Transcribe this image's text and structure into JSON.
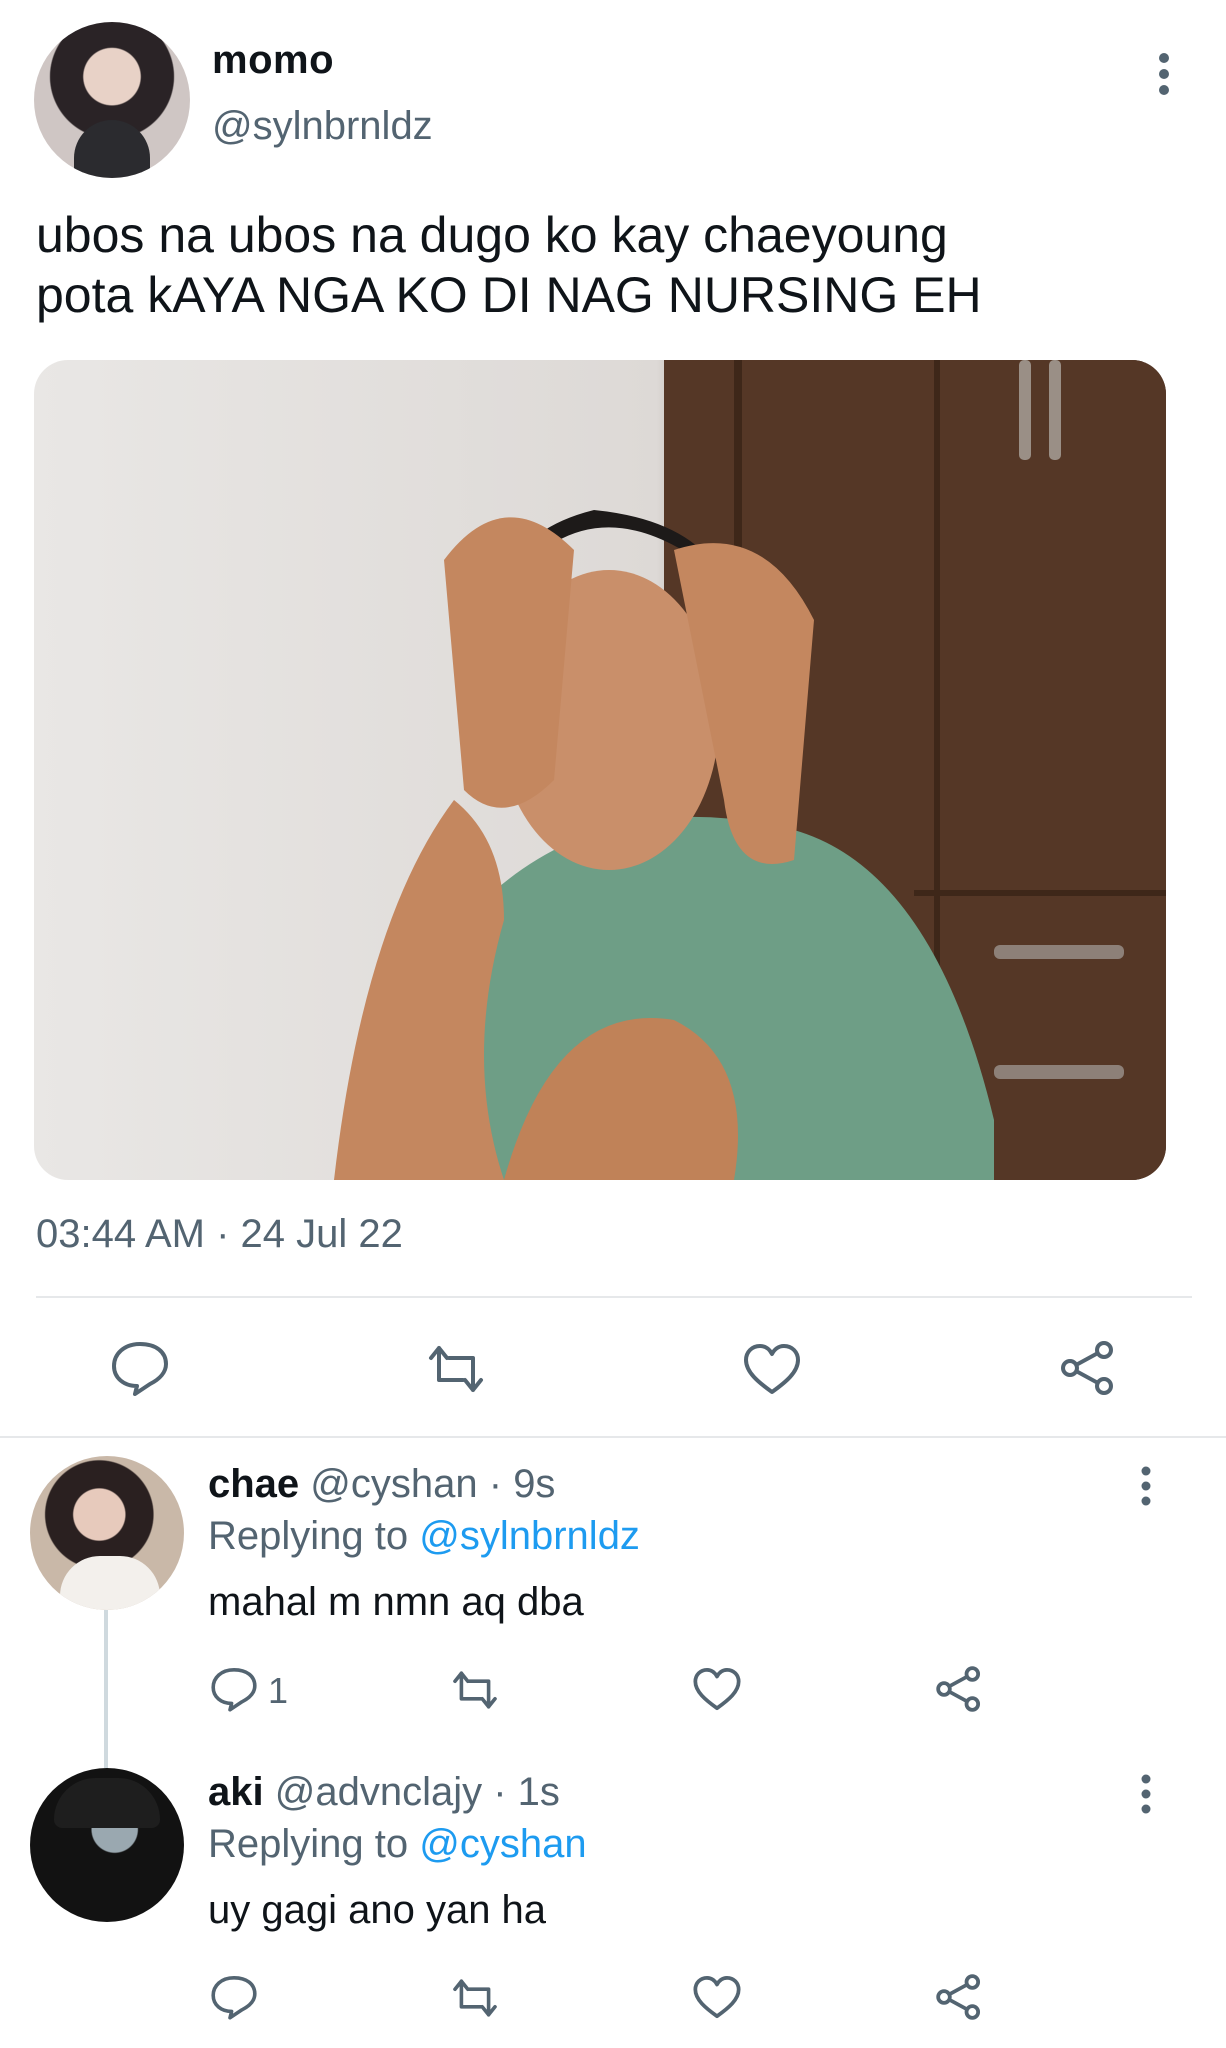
{
  "tweet": {
    "author_name": "momo",
    "author_handle": "@sylnbrnldz",
    "text_line1": "ubos na ubos na dugo ko kay chaeyoung",
    "text_line2": "pota kAYA NGA KO DI NAG NURSING EH",
    "timestamp": "03:44 AM · 24 Jul 22",
    "actions": [
      "reply-icon",
      "retweet-icon",
      "like-icon",
      "share-icon"
    ]
  },
  "replies": [
    {
      "name": "chae",
      "handle_time": "@cyshan · 9s",
      "replying_prefix": "Replying to",
      "replying_to": "@sylnbrnldz",
      "text": "mahal m nmn aq dba",
      "reply_count": "1"
    },
    {
      "name": "aki",
      "handle_time": "@advnclajy · 1s",
      "replying_prefix": "Replying to",
      "replying_to": "@cyshan",
      "text": "uy gagi ano yan ha",
      "reply_count": ""
    }
  ],
  "colors": {
    "link": "#1d9bf0",
    "muted": "#536471",
    "divider": "#e6e8ea"
  }
}
